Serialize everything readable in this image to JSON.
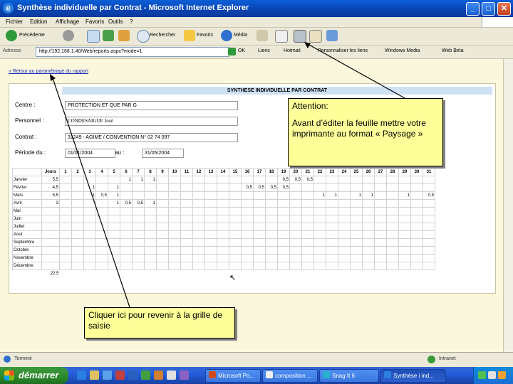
{
  "window": {
    "title": "Synthèse individuelle par Contrat - Microsoft Internet Explorer",
    "accent": "#0842b0"
  },
  "menu": {
    "items": [
      "Fichier",
      "Edition",
      "Affichage",
      "Favoris",
      "Outils",
      "?"
    ]
  },
  "toolbar": {
    "back_label": "Précédente",
    "search_label": "Rechercher",
    "favorites_label": "Favoris",
    "media_label": "Média"
  },
  "addressbar": {
    "label": "Adresse",
    "url": "http://192.168.1.40/Web/reports.aspx?mode=1",
    "go_label": "OK",
    "links": [
      "Liens",
      "Hotmail",
      "Personnaliser les liens",
      "Windows Media",
      "Web Beta"
    ]
  },
  "page": {
    "back_link": "« Retour au paramétrage du rapport",
    "report_title": "SYNTHESE INDIVIDUELLE PAR CONTRAT",
    "fields": {
      "centre_label": "Centre :",
      "centre_value": "PROTECTION ET QUE PAR G",
      "personnel_label": "Personnel :",
      "personnel_value": "CONDESAIGUE José",
      "contrat_label": "Contrat :",
      "contrat_value": "31249 - AGIME / CONVENTION N° 02 74 097",
      "periode_label": "Période du :",
      "date_from": "01/01/2004",
      "au_label": "au :",
      "date_to": "31/05/2004"
    },
    "table": {
      "header": [
        "",
        "Jours",
        "1",
        "2",
        "3",
        "4",
        "5",
        "6",
        "7",
        "8",
        "9",
        "10",
        "11",
        "12",
        "13",
        "14",
        "15",
        "16",
        "17",
        "18",
        "19",
        "20",
        "21",
        "22",
        "23",
        "24",
        "25",
        "26",
        "27",
        "28",
        "29",
        "30",
        "31"
      ],
      "rows": [
        {
          "month": "Janvier",
          "total": "5,5",
          "days": {
            "6": "1",
            "7": "1",
            "8": "1",
            "19": "0,5",
            "20": "0,5",
            "21": "0,5"
          }
        },
        {
          "month": "Février",
          "total": "4,5",
          "days": {
            "3": "1",
            "5": "1",
            "16": "0,5",
            "17": "0,5",
            "18": "0,5",
            "19": "0,5"
          }
        },
        {
          "month": "Mars",
          "total": "5,5",
          "days": {
            "3": "1",
            "4": "0,5",
            "5": "1",
            "22": "1",
            "23": "1",
            "25": "1",
            "26": "1",
            "29": "1",
            "31": "0,5"
          }
        },
        {
          "month": "Avril",
          "total": "3",
          "days": {
            "5": "1",
            "6": "0,5",
            "7": "0,5",
            "8": "1"
          }
        },
        {
          "month": "Mai",
          "total": "",
          "days": {}
        },
        {
          "month": "Juin",
          "total": "",
          "days": {}
        },
        {
          "month": "Juillet",
          "total": "",
          "days": {}
        },
        {
          "month": "Aout",
          "total": "",
          "days": {}
        },
        {
          "month": "Septembre",
          "total": "",
          "days": {}
        },
        {
          "month": "Octobre",
          "total": "",
          "days": {}
        },
        {
          "month": "Novembre",
          "total": "",
          "days": {}
        },
        {
          "month": "Décembre",
          "total": "",
          "days": {}
        }
      ],
      "grand_total": "22,5"
    }
  },
  "callouts": {
    "attention_title": "Attention:",
    "attention_body": "Avant d’éditer la feuille mettre votre imprimante au format « Paysage »",
    "back_hint": "Cliquer ici pour revenir à la grille de saisie",
    "fill": "#ffff99"
  },
  "statusbar": {
    "left": "Terminé",
    "zone": "Intranet"
  },
  "taskbar": {
    "start_label": "démarrer",
    "tasks": [
      "Microsoft Po...",
      "composition ...",
      "Snag It 6",
      "Synthèse i ind..."
    ],
    "clock": ""
  }
}
